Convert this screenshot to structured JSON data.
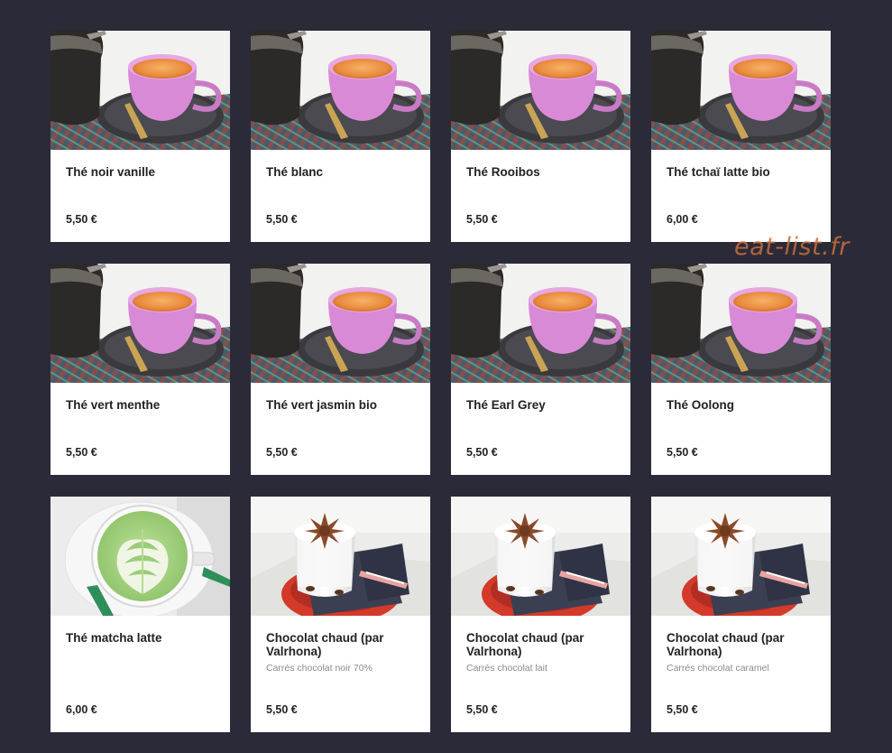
{
  "watermark": "eat-list.fr",
  "colors": {
    "background": "#2b2a38",
    "card": "#ffffff",
    "watermark": "#c86f3c"
  },
  "items": [
    {
      "name": "Thé noir vanille",
      "desc": "",
      "price": "5,50 €",
      "image": "tea-cup-photo"
    },
    {
      "name": "Thé blanc",
      "desc": "",
      "price": "5,50 €",
      "image": "tea-cup-photo"
    },
    {
      "name": "Thé Rooibos",
      "desc": "",
      "price": "5,50 €",
      "image": "tea-cup-photo"
    },
    {
      "name": "Thé tchaï latte bio",
      "desc": "",
      "price": "6,00 €",
      "image": "tea-cup-photo"
    },
    {
      "name": "Thé vert menthe",
      "desc": "",
      "price": "5,50 €",
      "image": "tea-cup-photo"
    },
    {
      "name": "Thé vert jasmin bio",
      "desc": "",
      "price": "5,50 €",
      "image": "tea-cup-photo"
    },
    {
      "name": "Thé Earl Grey",
      "desc": "",
      "price": "5,50 €",
      "image": "tea-cup-photo"
    },
    {
      "name": "Thé Oolong",
      "desc": "",
      "price": "5,50 €",
      "image": "tea-cup-photo"
    },
    {
      "name": "Thé matcha latte",
      "desc": "",
      "price": "6,00 €",
      "image": "matcha-latte-photo"
    },
    {
      "name": "Chocolat chaud (par Valrhona)",
      "desc": "Carrés chocolat noir 70%",
      "price": "5,50 €",
      "image": "hot-chocolate-photo"
    },
    {
      "name": "Chocolat chaud (par Valrhona)",
      "desc": "Carrés chocolat lait",
      "price": "5,50 €",
      "image": "hot-chocolate-photo"
    },
    {
      "name": "Chocolat chaud (par Valrhona)",
      "desc": "Carrés chocolat caramel",
      "price": "5,50 €",
      "image": "hot-chocolate-photo"
    }
  ]
}
